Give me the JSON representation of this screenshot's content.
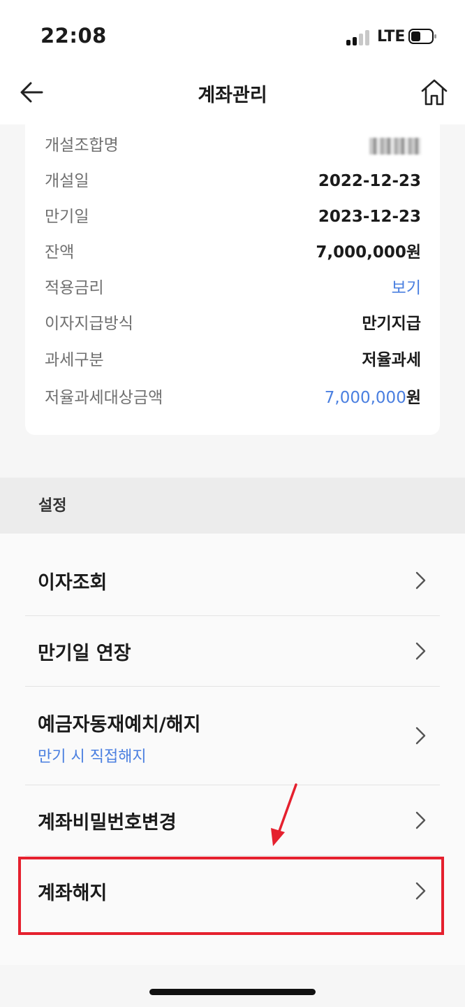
{
  "status_bar": {
    "time": "22:08",
    "network": "LTE",
    "signal_icon": "cellular-signal-icon",
    "battery_icon": "battery-icon"
  },
  "header": {
    "title": "계좌관리",
    "back_icon": "back-arrow-icon",
    "home_icon": "home-icon"
  },
  "account_info": {
    "rows": [
      {
        "label": "개설조합명",
        "value": ""
      },
      {
        "label": "개설일",
        "value": "2022-12-23"
      },
      {
        "label": "만기일",
        "value": "2023-12-23"
      },
      {
        "label": "잔액",
        "value": "7,000,000원"
      },
      {
        "label": "적용금리",
        "value": "보기"
      },
      {
        "label": "이자지급방식",
        "value": "만기지급"
      },
      {
        "label": "과세구분",
        "value": "저율과세"
      },
      {
        "label": "저율과세대상금액",
        "value_number": "7,000,000",
        "value_unit": "원"
      }
    ]
  },
  "settings": {
    "section_title": "설정",
    "items": [
      {
        "label": "이자조회"
      },
      {
        "label": "만기일 연장"
      },
      {
        "label": "예금자동재예치/해지",
        "sublabel": "만기 시 직접해지"
      },
      {
        "label": "계좌비밀번호변경"
      },
      {
        "label": "계좌해지"
      }
    ]
  },
  "colors": {
    "accent_blue": "#4a7fe0",
    "highlight_red": "#e5202e"
  }
}
